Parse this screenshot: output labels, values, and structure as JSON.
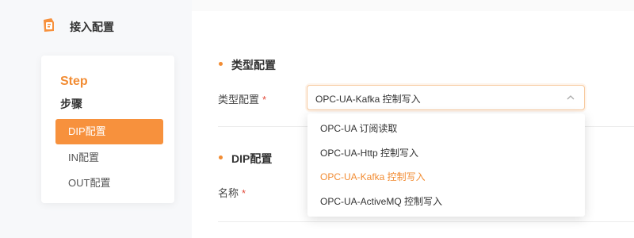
{
  "sidebar": {
    "app_title": "接入配置",
    "logo_icon": "document-gear-icon",
    "step_title": "Step",
    "step_subtitle": "步骤",
    "items": [
      {
        "label": "DIP配置",
        "active": true
      },
      {
        "label": "IN配置",
        "active": false
      },
      {
        "label": "OUT配置",
        "active": false
      }
    ]
  },
  "main": {
    "type_section": {
      "title": "类型配置",
      "field_label": "类型配置",
      "required_mark": "*",
      "select_value": "OPC-UA-Kafka 控制写入",
      "options": [
        {
          "label": "OPC-UA 订阅读取",
          "selected": false
        },
        {
          "label": "OPC-UA-Http 控制写入",
          "selected": false
        },
        {
          "label": "OPC-UA-Kafka 控制写入",
          "selected": true
        },
        {
          "label": "OPC-UA-ActiveMQ 控制写入",
          "selected": false
        }
      ]
    },
    "dip_section": {
      "title": "DIP配置",
      "name_label": "名称",
      "required_mark": "*"
    }
  },
  "colors": {
    "accent": "#f28c33",
    "active_bg": "#f7913d",
    "required": "#e24b3b"
  }
}
